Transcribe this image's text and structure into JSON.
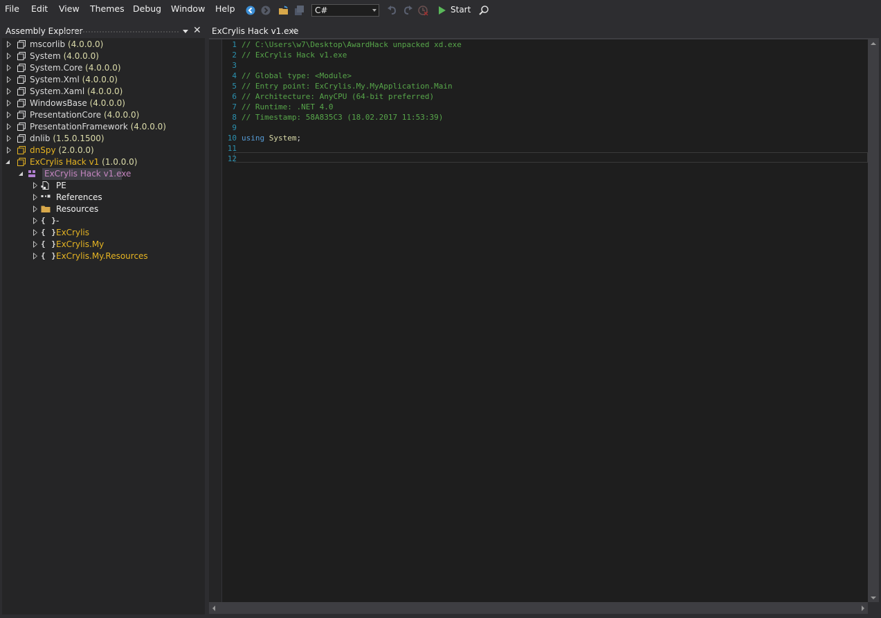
{
  "menu": [
    "File",
    "Edit",
    "View",
    "Themes",
    "Debug",
    "Window",
    "Help"
  ],
  "toolbar": {
    "language": "C#",
    "start_label": "Start",
    "icons": [
      "back-icon",
      "forward-icon",
      "open-icon",
      "save-icon",
      "undo-icon",
      "redo-icon",
      "clear-history-icon",
      "play-icon",
      "search-icon"
    ]
  },
  "explorer": {
    "title": "Assembly Explorer",
    "assemblies": [
      {
        "name": "mscorlib",
        "version": "(4.0.0.0)"
      },
      {
        "name": "System",
        "version": "(4.0.0.0)"
      },
      {
        "name": "System.Core",
        "version": "(4.0.0.0)"
      },
      {
        "name": "System.Xml",
        "version": "(4.0.0.0)"
      },
      {
        "name": "System.Xaml",
        "version": "(4.0.0.0)"
      },
      {
        "name": "WindowsBase",
        "version": "(4.0.0.0)"
      },
      {
        "name": "PresentationCore",
        "version": "(4.0.0.0)"
      },
      {
        "name": "PresentationFramework",
        "version": "(4.0.0.0)"
      },
      {
        "name": "dnlib",
        "version": "(1.5.0.1500)"
      },
      {
        "name": "dnSpy",
        "version": "(2.0.0.0)"
      },
      {
        "name": "ExCrylis Hack v1",
        "version": "(1.0.0.0)"
      }
    ],
    "module": "ExCrylis Hack v1.exe",
    "children": [
      {
        "name": "PE",
        "icon": "pe-file-icon"
      },
      {
        "name": "References",
        "icon": "references-icon"
      },
      {
        "name": "Resources",
        "icon": "folder-icon"
      },
      {
        "name": "-",
        "icon": "namespace-icon"
      },
      {
        "name": "ExCrylis",
        "icon": "namespace-icon"
      },
      {
        "name": "ExCrylis.My",
        "icon": "namespace-icon"
      },
      {
        "name": "ExCrylis.My.Resources",
        "icon": "namespace-icon"
      }
    ]
  },
  "tab": {
    "label": "ExCrylis Hack v1.exe"
  },
  "editor": {
    "lines": [
      {
        "n": "1",
        "text": "// C:\\Users\\w7\\Desktop\\AwardHack unpacked xd.exe"
      },
      {
        "n": "2",
        "text": "// ExCrylis Hack v1.exe"
      },
      {
        "n": "3",
        "text": ""
      },
      {
        "n": "4",
        "text": "// Global type: <Module>"
      },
      {
        "n": "5",
        "text": "// Entry point: ExCrylis.My.MyApplication.Main"
      },
      {
        "n": "6",
        "text": "// Architecture: AnyCPU (64-bit preferred)"
      },
      {
        "n": "7",
        "text": "// Runtime: .NET 4.0"
      },
      {
        "n": "8",
        "text": "// Timestamp: 58A835C3 (18.02.2017 11:53:39)"
      },
      {
        "n": "9",
        "text": ""
      },
      {
        "n": "10",
        "kw": "using",
        "type": "System",
        "punct": ";"
      },
      {
        "n": "11",
        "text": ""
      },
      {
        "n": "12",
        "text": ""
      }
    ]
  },
  "colors": {
    "comment": "#57a64a",
    "keyword": "#569cd6",
    "type": "#dcdcaa",
    "line_number": "#2b91af",
    "namespace": "#e6b422",
    "module": "#c586c0"
  }
}
